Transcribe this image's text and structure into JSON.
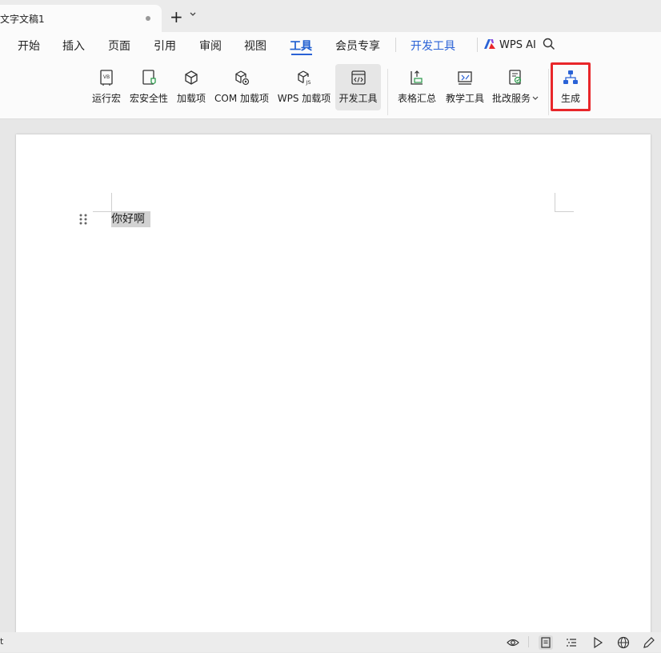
{
  "tabbar": {
    "doc_title": "文字文稿1",
    "new_tab": "+",
    "chevron": "⌄"
  },
  "menu": {
    "items": [
      "开始",
      "插入",
      "页面",
      "引用",
      "审阅",
      "视图",
      "工具",
      "会员专享"
    ],
    "active_index": 6,
    "devtools": "开发工具",
    "wps_ai": "WPS AI"
  },
  "ribbon": {
    "buttons": [
      {
        "label": "运行宏",
        "icon": "run-macro-icon"
      },
      {
        "label": "宏安全性",
        "icon": "macro-security-icon"
      },
      {
        "label": "加载项",
        "icon": "addin-icon"
      },
      {
        "label": "COM 加载项",
        "icon": "com-addin-icon"
      },
      {
        "label": "WPS 加载项",
        "icon": "wps-addin-icon"
      },
      {
        "label": "开发工具",
        "icon": "devtools-icon",
        "selected": true
      },
      {
        "label": "表格汇总",
        "icon": "table-summary-icon"
      },
      {
        "label": "教学工具",
        "icon": "teaching-tools-icon"
      },
      {
        "label": "批改服务",
        "icon": "correction-service-icon",
        "has_dropdown": true
      },
      {
        "label": "生成",
        "icon": "generate-icon",
        "highlighted": true
      }
    ]
  },
  "document": {
    "paragraph": "你好啊"
  },
  "statusbar": {
    "left_text": "t",
    "icons": [
      "eye-icon",
      "page-view-icon",
      "outline-icon",
      "play-icon",
      "globe-icon",
      "pen-icon"
    ],
    "active_icon": "page-view-icon"
  },
  "colors": {
    "accent": "#2a62d6",
    "highlight_box": "#e8262a",
    "selection": "#d2d2d2"
  }
}
